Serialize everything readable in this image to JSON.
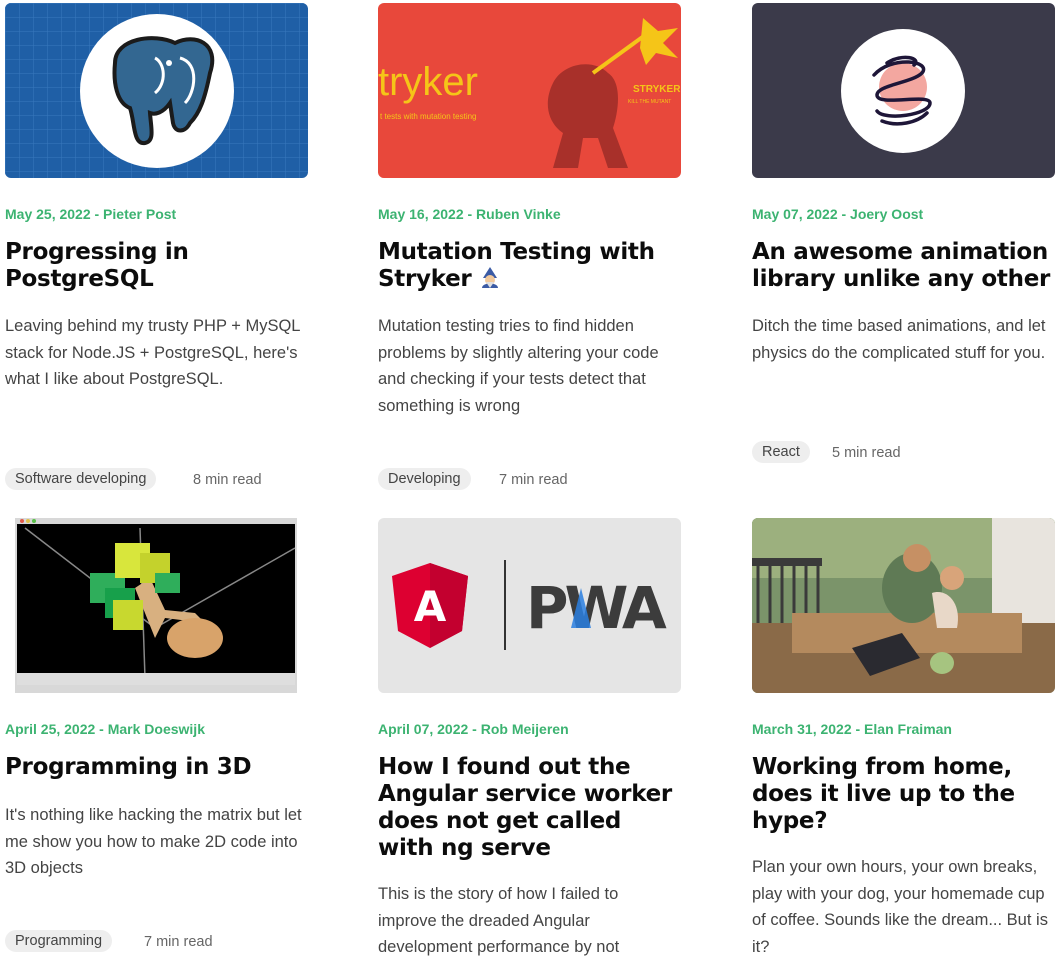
{
  "posts": [
    {
      "meta": "May 25, 2022 - Pieter Post",
      "title": "Progressing in PostgreSQL",
      "excerpt": "Leaving behind my trusty PHP + MySQL stack for Node.JS + PostgreSQL, here's what I like about PostgreSQL.",
      "tag": "Software developing",
      "read_time": "8 min read",
      "image": "postgresql-elephant-logo"
    },
    {
      "meta": "May 16, 2022 - Ruben Vinke",
      "title": "Mutation Testing with Stryker",
      "excerpt": "Mutation testing tries to find hidden problems by slightly altering your code and checking if your tests detect that something is wrong",
      "tag": "Developing",
      "read_time": "7 min read",
      "image": "stryker-banner",
      "banner_word": "tryker",
      "banner_sub": "t tests with mutation testing",
      "banner_badge": "STRYKER",
      "banner_badge_sub": "KILL THE MUTANT"
    },
    {
      "meta": "May 07, 2022 - Joery Oost",
      "title": "An awesome animation library unlike any other",
      "excerpt": "Ditch the time based animations, and let physics do the complicated stuff for you.",
      "tag": "React",
      "read_time": "5 min read",
      "image": "animation-library-logo"
    },
    {
      "meta": "April 25, 2022 - Mark Doeswijk",
      "title": "Programming in 3D",
      "excerpt": "It's nothing like hacking the matrix but let me show you how to make 2D code into 3D objects",
      "tag": "Programming",
      "read_time": "7 min read",
      "image": "3d-tree-render"
    },
    {
      "meta": "April 07, 2022 - Rob Meijeren",
      "title": "How I found out the Angular service worker does not get called with ng serve",
      "excerpt": "This is the story of how I failed to improve the dreaded Angular development performance by not",
      "image": "angular-pwa-logos",
      "pwa_text": "PWA"
    },
    {
      "meta": "March 31, 2022 - Elan Fraiman",
      "title": "Working from home, does it live up to the hype?",
      "excerpt": "Plan your own hours, your own breaks, play with your dog, your homemade cup of coffee. Sounds like the dream... But is it?",
      "image": "working-from-home-photo"
    }
  ],
  "colors": {
    "accent": "#3cb371",
    "postgres_bg": "#1f5fa6",
    "stryker_bg": "#e8483b",
    "animation_bg": "#3b3a4a",
    "angular_red": "#dd0031",
    "pwa_blue": "#2a7fe0"
  }
}
